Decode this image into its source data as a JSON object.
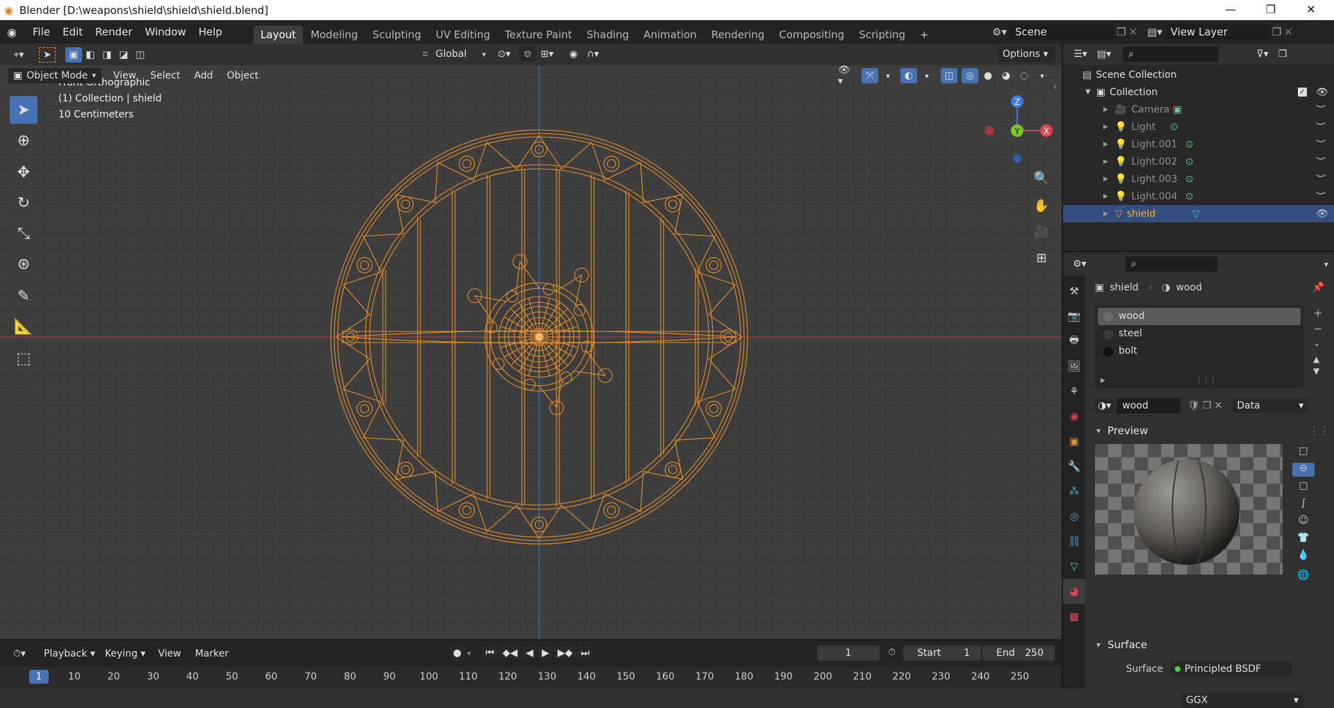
{
  "window": {
    "title": "Blender [D:\\weapons\\shield\\shield\\shield.blend]",
    "minimize": "—",
    "maximize": "❐",
    "close": "✕"
  },
  "menu": [
    "File",
    "Edit",
    "Render",
    "Window",
    "Help"
  ],
  "workspaces": [
    "Layout",
    "Modeling",
    "Sculpting",
    "UV Editing",
    "Texture Paint",
    "Shading",
    "Animation",
    "Rendering",
    "Compositing",
    "Scripting"
  ],
  "active_workspace": "Layout",
  "scene": {
    "name": "Scene",
    "view_layer": "View Layer"
  },
  "tool_header": {
    "orientation": "Global",
    "options": "Options"
  },
  "viewport_header": {
    "mode": "Object Mode",
    "menus": [
      "View",
      "Select",
      "Add",
      "Object"
    ]
  },
  "viewport": {
    "view_name": "Front Orthographic",
    "collection_info": "(1) Collection | shield",
    "scale_info": "10 Centimeters",
    "gizmo": {
      "z": "Z",
      "y": "Y",
      "x": "X"
    }
  },
  "outliner": {
    "root": "Scene Collection",
    "collection": "Collection",
    "items": [
      {
        "name": "Camera",
        "type": "camera"
      },
      {
        "name": "Light",
        "type": "light"
      },
      {
        "name": "Light.001",
        "type": "light"
      },
      {
        "name": "Light.002",
        "type": "light"
      },
      {
        "name": "Light.003",
        "type": "light"
      },
      {
        "name": "Light.004",
        "type": "light"
      },
      {
        "name": "shield",
        "type": "mesh",
        "selected": true
      }
    ]
  },
  "properties": {
    "breadcrumb_object": "shield",
    "breadcrumb_material": "wood",
    "slots": [
      {
        "name": "wood",
        "color": "#6b6b6b",
        "selected": true
      },
      {
        "name": "steel",
        "color": "#3a3a3a"
      },
      {
        "name": "bolt",
        "color": "#111111"
      }
    ],
    "material_name": "wood",
    "link": "Data",
    "preview_label": "Preview",
    "surface_panel": "Surface",
    "surface_label": "Surface",
    "surface_value": "Principled BSDF",
    "distribution": "GGX"
  },
  "timeline": {
    "menus": [
      "Playback",
      "Keying",
      "View",
      "Marker"
    ],
    "current_frame": "1",
    "start_label": "Start",
    "start_value": "1",
    "end_label": "End",
    "end_value": "250",
    "ruler_current": "1",
    "ticks": [
      "10",
      "20",
      "30",
      "40",
      "50",
      "60",
      "70",
      "80",
      "90",
      "100",
      "110",
      "120",
      "130",
      "140",
      "150",
      "160",
      "170",
      "180",
      "190",
      "200",
      "210",
      "220",
      "230",
      "240",
      "250"
    ]
  },
  "colors": {
    "accent": "#4772b3",
    "selection": "#e8902a",
    "x_axis": "#c44855",
    "y_axis": "#6ba82c",
    "z_axis": "#3b7de0"
  }
}
